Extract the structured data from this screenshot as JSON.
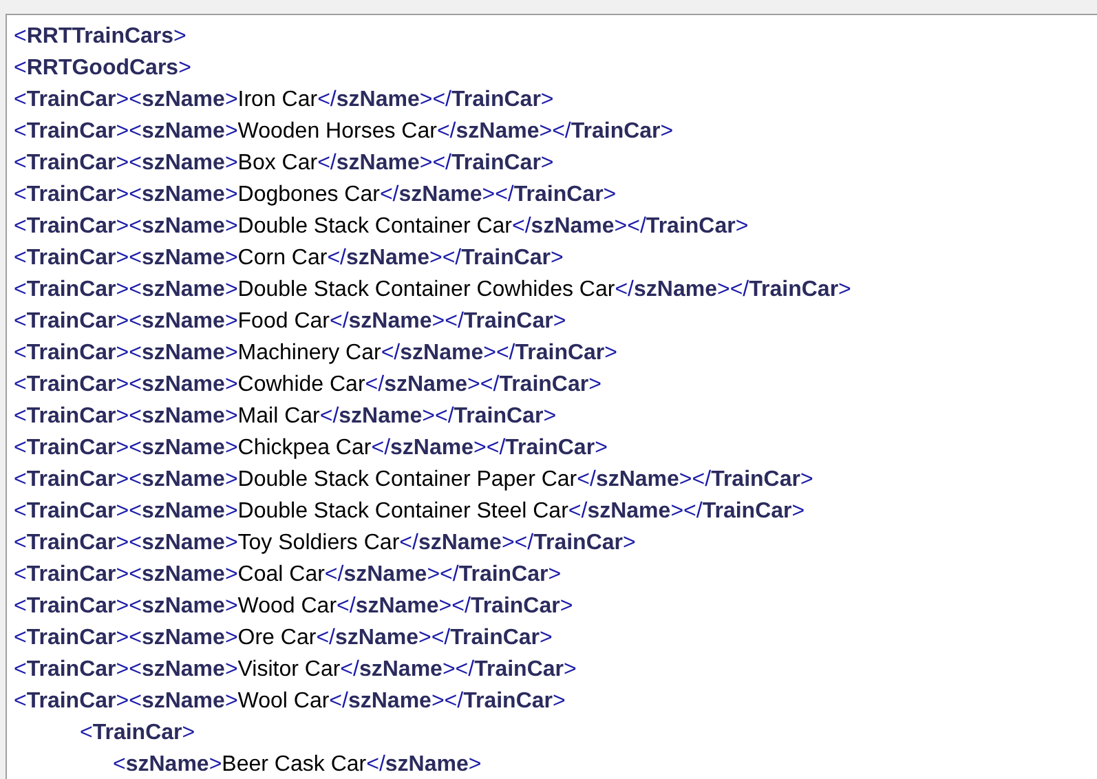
{
  "nodes": [
    {
      "kind": "raw",
      "parts": [
        {
          "kind": "markup",
          "text": "<**RRTTrainCars**>"
        }
      ],
      "children": [
        {
          "kind": "raw",
          "parts": [
            {
              "kind": "markup",
              "text": "<**RRTGoodCars**>"
            }
          ],
          "children": [
            {
              "kind": "raw",
              "parts": [
                {
                  "kind": "markup",
                  "text": "<**TrainCar**><**szName**>"
                },
                {
                  "kind": "value",
                  "text": "Iron Car"
                },
                {
                  "kind": "markup",
                  "text": "</**szName**></**TrainCar**>"
                }
              ]
            },
            {
              "kind": "raw",
              "parts": [
                {
                  "kind": "markup",
                  "text": "<**TrainCar**><**szName**>"
                },
                {
                  "kind": "value",
                  "text": "Wooden Horses Car"
                },
                {
                  "kind": "markup",
                  "text": "</**szName**></**TrainCar**>"
                }
              ]
            },
            {
              "kind": "raw",
              "parts": [
                {
                  "kind": "markup",
                  "text": "<**TrainCar**><**szName**>"
                },
                {
                  "kind": "value",
                  "text": "Box Car"
                },
                {
                  "kind": "markup",
                  "text": "</**szName**></**TrainCar**>"
                }
              ]
            },
            {
              "kind": "raw",
              "parts": [
                {
                  "kind": "markup",
                  "text": "<**TrainCar**><**szName**>"
                },
                {
                  "kind": "value",
                  "text": "Dogbones Car"
                },
                {
                  "kind": "markup",
                  "text": "</**szName**></**TrainCar**>"
                }
              ]
            },
            {
              "kind": "raw",
              "parts": [
                {
                  "kind": "markup",
                  "text": "<**TrainCar**><**szName**>"
                },
                {
                  "kind": "value",
                  "text": "Double Stack Container Car"
                },
                {
                  "kind": "markup",
                  "text": "</**szName**></**TrainCar**>"
                }
              ]
            },
            {
              "kind": "raw",
              "parts": [
                {
                  "kind": "markup",
                  "text": "<**TrainCar**><**szName**>"
                },
                {
                  "kind": "value",
                  "text": "Corn Car"
                },
                {
                  "kind": "markup",
                  "text": "</**szName**></**TrainCar**>"
                }
              ]
            },
            {
              "kind": "raw",
              "parts": [
                {
                  "kind": "markup",
                  "text": "<**TrainCar**><**szName**>"
                },
                {
                  "kind": "value",
                  "text": "Double Stack Container Cowhides Car"
                },
                {
                  "kind": "markup",
                  "text": "</**szName**></**TrainCar**>"
                }
              ]
            },
            {
              "kind": "raw",
              "parts": [
                {
                  "kind": "markup",
                  "text": "<**TrainCar**><**szName**>"
                },
                {
                  "kind": "value",
                  "text": "Food Car"
                },
                {
                  "kind": "markup",
                  "text": "</**szName**></**TrainCar**>"
                }
              ]
            },
            {
              "kind": "raw",
              "parts": [
                {
                  "kind": "markup",
                  "text": "<**TrainCar**><**szName**>"
                },
                {
                  "kind": "value",
                  "text": "Machinery Car"
                },
                {
                  "kind": "markup",
                  "text": "</**szName**></**TrainCar**>"
                }
              ]
            },
            {
              "kind": "raw",
              "parts": [
                {
                  "kind": "markup",
                  "text": "<**TrainCar**><**szName**>"
                },
                {
                  "kind": "value",
                  "text": "Cowhide Car"
                },
                {
                  "kind": "markup",
                  "text": "</**szName**></**TrainCar**>"
                }
              ]
            },
            {
              "kind": "raw",
              "parts": [
                {
                  "kind": "markup",
                  "text": "<**TrainCar**><**szName**>"
                },
                {
                  "kind": "value",
                  "text": "Mail Car"
                },
                {
                  "kind": "markup",
                  "text": "</**szName**></**TrainCar**>"
                }
              ]
            },
            {
              "kind": "raw",
              "parts": [
                {
                  "kind": "markup",
                  "text": "<**TrainCar**><**szName**>"
                },
                {
                  "kind": "value",
                  "text": "Chickpea Car"
                },
                {
                  "kind": "markup",
                  "text": "</**szName**></**TrainCar**>"
                }
              ]
            },
            {
              "kind": "raw",
              "parts": [
                {
                  "kind": "markup",
                  "text": "<**TrainCar**><**szName**>"
                },
                {
                  "kind": "value",
                  "text": "Double Stack Container Paper Car"
                },
                {
                  "kind": "markup",
                  "text": "</**szName**></**TrainCar**>"
                }
              ]
            },
            {
              "kind": "raw",
              "parts": [
                {
                  "kind": "markup",
                  "text": "<**TrainCar**><**szName**>"
                },
                {
                  "kind": "value",
                  "text": "Double Stack Container Steel Car"
                },
                {
                  "kind": "markup",
                  "text": "</**szName**></**TrainCar**>"
                }
              ]
            },
            {
              "kind": "raw",
              "parts": [
                {
                  "kind": "markup",
                  "text": "<**TrainCar**><**szName**>"
                },
                {
                  "kind": "value",
                  "text": "Toy Soldiers Car"
                },
                {
                  "kind": "markup",
                  "text": "</**szName**></**TrainCar**>"
                }
              ]
            },
            {
              "kind": "raw",
              "parts": [
                {
                  "kind": "markup",
                  "text": "<**TrainCar**><**szName**>"
                },
                {
                  "kind": "value",
                  "text": "Coal Car"
                },
                {
                  "kind": "markup",
                  "text": "</**szName**></**TrainCar**>"
                }
              ]
            },
            {
              "kind": "raw",
              "parts": [
                {
                  "kind": "markup",
                  "text": "<**TrainCar**><**szName**>"
                },
                {
                  "kind": "value",
                  "text": "Wood Car"
                },
                {
                  "kind": "markup",
                  "text": "</**szName**></**TrainCar**>"
                }
              ]
            },
            {
              "kind": "raw",
              "parts": [
                {
                  "kind": "markup",
                  "text": "<**TrainCar**><**szName**>"
                },
                {
                  "kind": "value",
                  "text": "Ore Car"
                },
                {
                  "kind": "markup",
                  "text": "</**szName**></**TrainCar**>"
                }
              ]
            },
            {
              "kind": "raw",
              "parts": [
                {
                  "kind": "markup",
                  "text": "<**TrainCar**><**szName**>"
                },
                {
                  "kind": "value",
                  "text": "Visitor Car"
                },
                {
                  "kind": "markup",
                  "text": "</**szName**></**TrainCar**>"
                }
              ]
            },
            {
              "kind": "raw",
              "parts": [
                {
                  "kind": "markup",
                  "text": "<**TrainCar**><**szName**>"
                },
                {
                  "kind": "value",
                  "text": "Wool Car"
                },
                {
                  "kind": "markup",
                  "text": "</**szName**></**TrainCar**>"
                }
              ]
            },
            {
              "kind": "formatted",
              "parts": [
                {
                  "kind": "markup",
                  "text": "<**TrainCar**>"
                }
              ],
              "children": [
                {
                  "kind": "formatted",
                  "parts": [
                    {
                      "kind": "markup",
                      "text": "<**szName**>"
                    },
                    {
                      "kind": "value",
                      "text": "Beer Cask Car"
                    },
                    {
                      "kind": "markup",
                      "text": "</**szName**>"
                    }
                  ]
                }
              ]
            }
          ]
        }
      ]
    }
  ]
}
